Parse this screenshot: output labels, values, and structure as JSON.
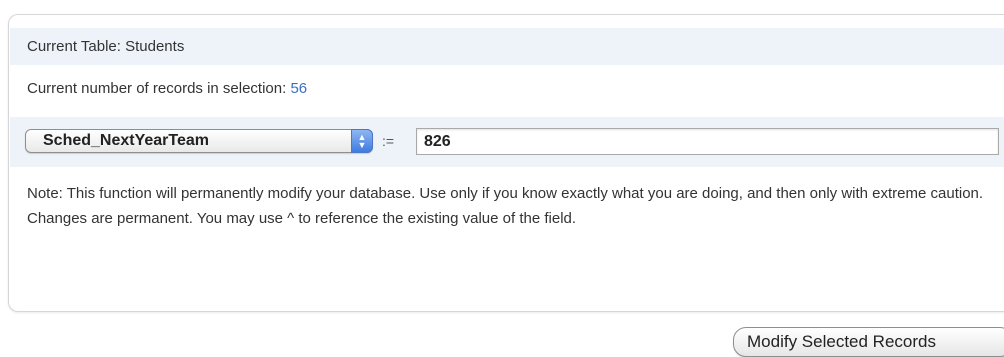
{
  "table_row": {
    "label": "Current Table: Students"
  },
  "count_row": {
    "label": "Current number of records in selection: ",
    "count": "56",
    "count_color": "#3a6fc4"
  },
  "edit_row": {
    "field_select_value": "Sched_NextYearTeam",
    "assign_operator": ":=",
    "value_input": "826"
  },
  "note": {
    "text": "Note: This function will permanently modify your database. Use only if you know exactly what you are doing, and then only with extreme caution. Changes are permanent. You may use ^ to reference the existing value of the field."
  },
  "actions": {
    "modify_button_label": "Modify Selected Records"
  },
  "colors": {
    "row_highlight": "#eef3fa",
    "accent_blue": "#3f7be0"
  }
}
